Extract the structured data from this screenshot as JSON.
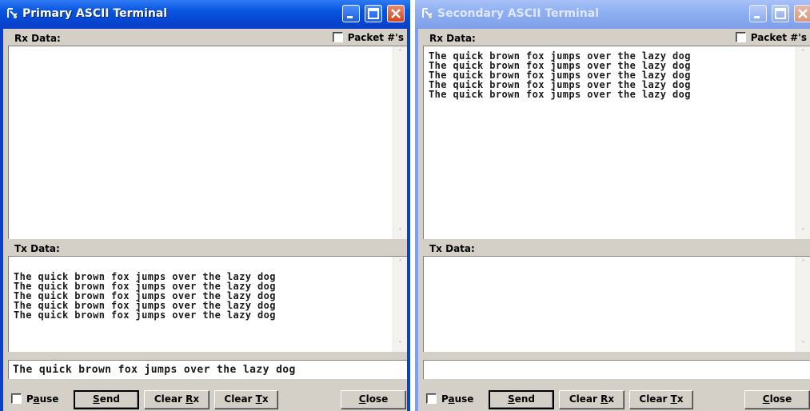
{
  "primary": {
    "title": "Primary ASCII Terminal",
    "rx_label": "Rx Data:",
    "packet_label": "Packet #'s",
    "packet_checked": false,
    "rx_lines": [],
    "tx_label": "Tx Data:",
    "tx_lines": [
      "The quick brown fox jumps over the lazy dog",
      "The quick brown fox jumps over the lazy dog",
      "The quick brown fox jumps over the lazy dog",
      "The quick brown fox jumps over the lazy dog",
      "The quick brown fox jumps over the lazy dog"
    ],
    "input_value": "The quick brown fox jumps over the lazy dog",
    "pause_label": "Pause",
    "pause_checked": false,
    "send_label": "Send",
    "clear_rx_label": "Clear Rx",
    "clear_tx_label": "Clear Tx",
    "close_label": "Close"
  },
  "secondary": {
    "title": "Secondary ASCII Terminal",
    "rx_label": "Rx Data:",
    "packet_label": "Packet #'s",
    "packet_checked": false,
    "rx_lines": [
      "The quick brown fox jumps over the lazy dog",
      "The quick brown fox jumps over the lazy dog",
      "The quick brown fox jumps over the lazy dog",
      "The quick brown fox jumps over the lazy dog",
      "The quick brown fox jumps over the lazy dog"
    ],
    "tx_label": "Tx Data:",
    "tx_lines": [],
    "input_value": "",
    "pause_label": "Pause",
    "pause_checked": false,
    "send_label": "Send",
    "clear_rx_label": "Clear Rx",
    "clear_tx_label": "Clear Tx",
    "close_label": "Close"
  },
  "icons": {
    "app": "terminal-app-icon",
    "minimize": "minimize-icon",
    "maximize": "maximize-icon",
    "close": "close-icon",
    "scroll_up": "scroll-up-icon",
    "scroll_down": "scroll-down-icon"
  },
  "colors": {
    "active_titlebar": "#0a58e0",
    "inactive_titlebar": "#8fb0f2",
    "dialog_face": "#d4d0c8",
    "close_button": "#d0471f"
  }
}
